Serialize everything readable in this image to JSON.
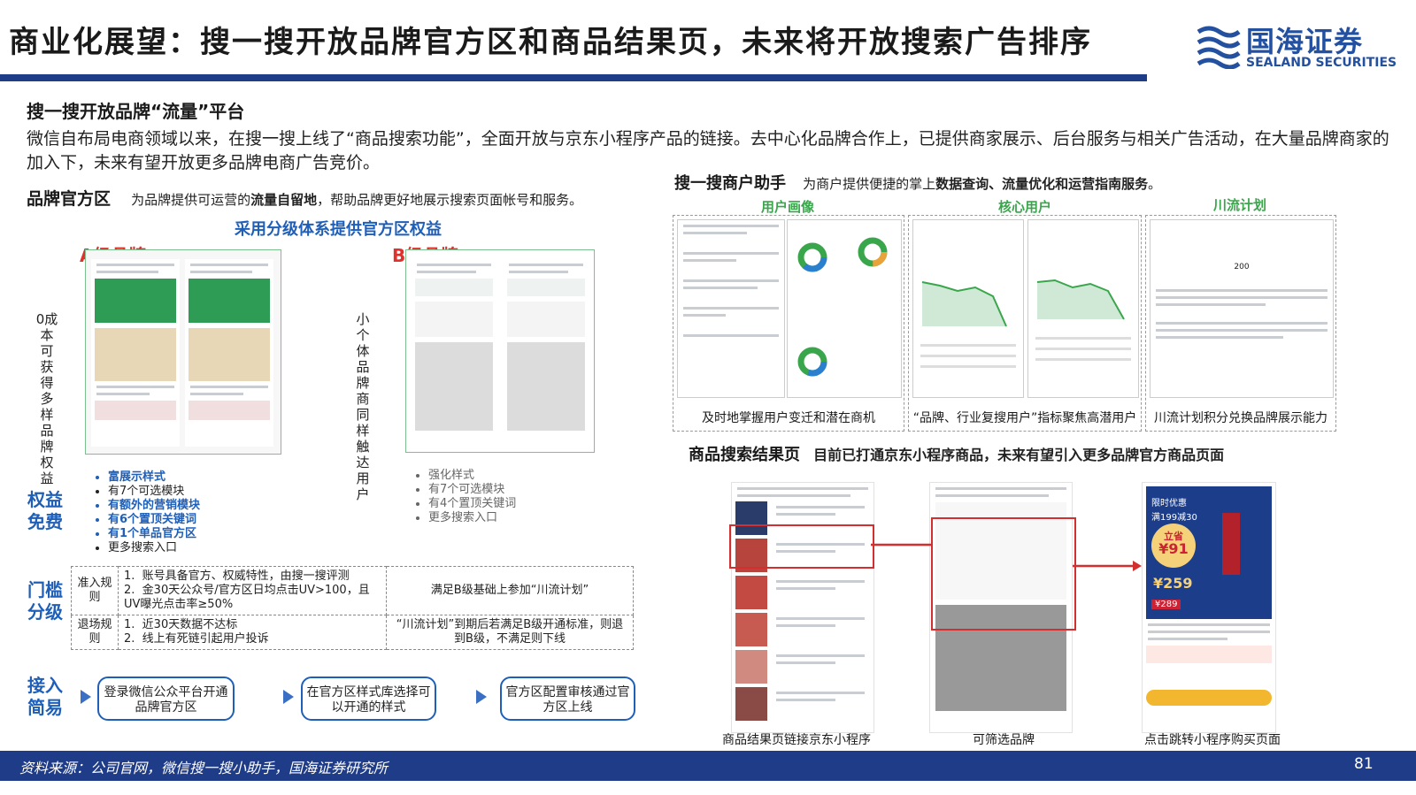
{
  "header": {
    "title": "商业化展望：搜一搜开放品牌官方区和商品结果页，未来将开放搜索广告排序",
    "logo_cn": "国海证券",
    "logo_en": "SEALAND SECURITIES"
  },
  "section_title": "搜一搜开放品牌“流量”平台",
  "intro": "微信自布局电商领域以来，在搜一搜上线了“商品搜索功能”，全面开放与京东小程序产品的链接。去中心化品牌合作上，已提供商家展示、后台服务与相关广告活动，在大量品牌商家的加入下，未来有望开放更多品牌电商广告竞价。",
  "brand_zone": {
    "title": "品牌官方区",
    "desc_pre": "为品牌提供可运营的",
    "desc_hl": "流量自留地",
    "desc_post": "，帮助品牌更好地展示搜索页面帐号和服务。",
    "tier_title": "采用分级体系提供官方区权益",
    "a_label": "A级品牌",
    "b_label": "B级品牌",
    "a_side": "0成本可获得多样品牌权益",
    "b_side": "小个体品牌商同样触达用户",
    "benefit_label": "权益免费",
    "a_benefits": [
      "富展示样式",
      "有7个可选模块",
      "有额外的营销模块",
      "有6个置顶关键词",
      "有1个单品官方区",
      "更多搜索入口"
    ],
    "b_benefits": [
      "强化样式",
      "有7个可选模块",
      "有4个置顶关键词",
      "更多搜索入口"
    ],
    "threshold_label": "门槛分级",
    "rules": {
      "entry_label": "准入规则",
      "entry_a": [
        "账号具备官方、权威特性，由搜一搜评测",
        "金30天公众号/官方区日均点击UV>100，且UV曝光点击率≥50%"
      ],
      "entry_b": "满足B级基础上参加“川流计划”",
      "exit_label": "退场规则",
      "exit_a": [
        "近30天数据不达标",
        "线上有死链引起用户投诉"
      ],
      "exit_b": "“川流计划”到期后若满足B级开通标准，则退到B级，不满足则下线"
    },
    "access_label": "接入简易",
    "steps": [
      "登录微信公众平台开通品牌官方区",
      "在官方区样式库选择可以开通的样式",
      "官方区配置审核通过官方区上线"
    ]
  },
  "merchant": {
    "title": "搜一搜商户助手",
    "desc_pre": "为商户提供便捷的掌上",
    "desc_hl": "数据查询、流量优化和运营指南服务",
    "desc_post": "。",
    "panels": [
      {
        "head": "用户画像",
        "caption": "及时地掌握用户变迁和潜在商机"
      },
      {
        "head": "核心用户",
        "caption": "“品牌、行业复搜用户”指标聚焦高潜用户"
      },
      {
        "head": "川流计划",
        "caption": "川流计划积分兑换品牌展示能力"
      }
    ],
    "points_value": "200"
  },
  "results": {
    "title": "商品搜索结果页",
    "desc": "目前已打通京东小程序商品，未来有望引入更多品牌官方商品页面",
    "captions": [
      "商品结果页链接京东小程序",
      "可筛选品牌",
      "点击跳转小程序购买页面"
    ],
    "promo": {
      "line1": "限时优惠",
      "line2": "满199减30",
      "line3": "立省",
      "price1": "¥91",
      "price2": "¥259",
      "price3": "¥289"
    }
  },
  "footer": {
    "source": "资料来源：公司官网，微信搜一搜小助手，国海证券研究所",
    "page": "81"
  },
  "colors": {
    "accent": "#1f3c88",
    "highlight": "#1f5fb8",
    "red": "#e0312c",
    "green": "#3aa64c"
  }
}
